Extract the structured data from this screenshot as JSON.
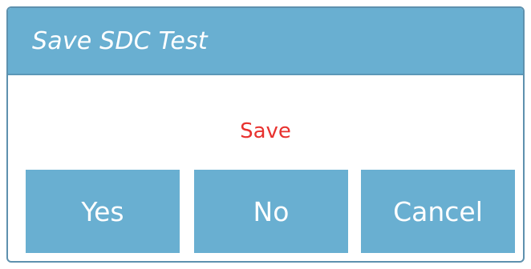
{
  "dialog": {
    "title": "Save SDC Test",
    "message": "Save",
    "buttons": {
      "yes": "Yes",
      "no": "No",
      "cancel": "Cancel"
    }
  },
  "colors": {
    "titlebar": "#69afd1",
    "button": "#69afd1",
    "border": "#5e91ae",
    "message": "#e8322f",
    "text_on_accent": "#ffffff"
  }
}
